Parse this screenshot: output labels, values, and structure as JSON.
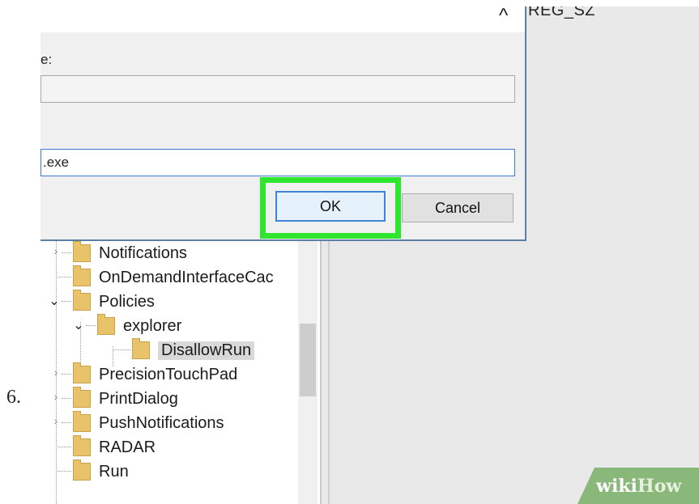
{
  "step_number": "6.",
  "dialog": {
    "value_name_label": "e:",
    "value_name": "",
    "value_data_value": ".exe",
    "ok_label": "OK",
    "cancel_label": "Cancel",
    "collapse_glyph": "^"
  },
  "list_header_type": "REG_SZ",
  "tree": {
    "items": [
      {
        "label": "Notifications",
        "state": "collapsed"
      },
      {
        "label": "OnDemandInterfaceCac",
        "state": "leaf"
      },
      {
        "label": "Policies",
        "state": "expanded"
      },
      {
        "label": "explorer",
        "state": "expanded"
      },
      {
        "label": "DisallowRun",
        "state": "selected"
      },
      {
        "label": "PrecisionTouchPad",
        "state": "collapsed"
      },
      {
        "label": "PrintDialog",
        "state": "collapsed"
      },
      {
        "label": "PushNotifications",
        "state": "collapsed"
      },
      {
        "label": "RADAR",
        "state": "leaf"
      },
      {
        "label": "Run",
        "state": "leaf"
      }
    ]
  },
  "icons": {
    "folder": "folder-icon",
    "expand": "chevron-right-icon",
    "collapse": "chevron-down-icon"
  },
  "colors": {
    "highlight": "#2ee62e",
    "folder": "#e8c36a",
    "ok_border": "#3d84d6"
  },
  "watermark": {
    "part1": "wiki",
    "part2": "How"
  }
}
